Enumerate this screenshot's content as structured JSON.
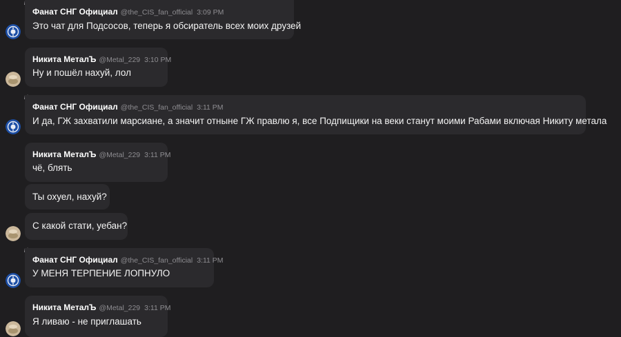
{
  "messages": [
    {
      "name": "Фанат СНГ Официал",
      "handle": "@the_CIS_fan_official",
      "time": "3:09 PM",
      "text": "Это чат для Подсосов, теперь я обсиратель всех моих друзей"
    },
    {
      "name": "Никита МеталЪ",
      "handle": "@Metal_229",
      "time": "3:10 PM",
      "text": "Ну и пошёл нахуй, лол"
    },
    {
      "name": "Фанат СНГ Официал",
      "handle": "@the_CIS_fan_official",
      "time": "3:11 PM",
      "text": "И да, ГЖ захватили марсиане, а значит отныне ГЖ правлю я, все Подпищики на веки станут моими Рабами включая Никиту метала"
    },
    {
      "name": "Никита МеталЪ",
      "handle": "@Metal_229",
      "time": "3:11 PM",
      "text": "чё, блять"
    },
    {
      "text": "Ты охуел, нахуй?"
    },
    {
      "text": "С какой стати, уебан?"
    },
    {
      "name": "Фанат СНГ Официал",
      "handle": "@the_CIS_fan_official",
      "time": "3:11 PM",
      "text": "У МЕНЯ ТЕРПЕНИЕ ЛОПНУЛО"
    },
    {
      "name": "Никита МеталЪ",
      "handle": "@Metal_229",
      "time": "3:11 PM",
      "text": "Я ливаю - не приглашать"
    }
  ],
  "colors": {
    "background": "#1f1e20",
    "bubble": "#2b2a2d",
    "meta": "#8e8d91",
    "avatar_fan": "#1d4fa6",
    "avatar_nikita": "#cbb89b"
  },
  "icons": {
    "admin_badge": "crown-icon",
    "fan_avatar": "cis-emblem-avatar",
    "nikita_avatar": "photo-avatar"
  }
}
